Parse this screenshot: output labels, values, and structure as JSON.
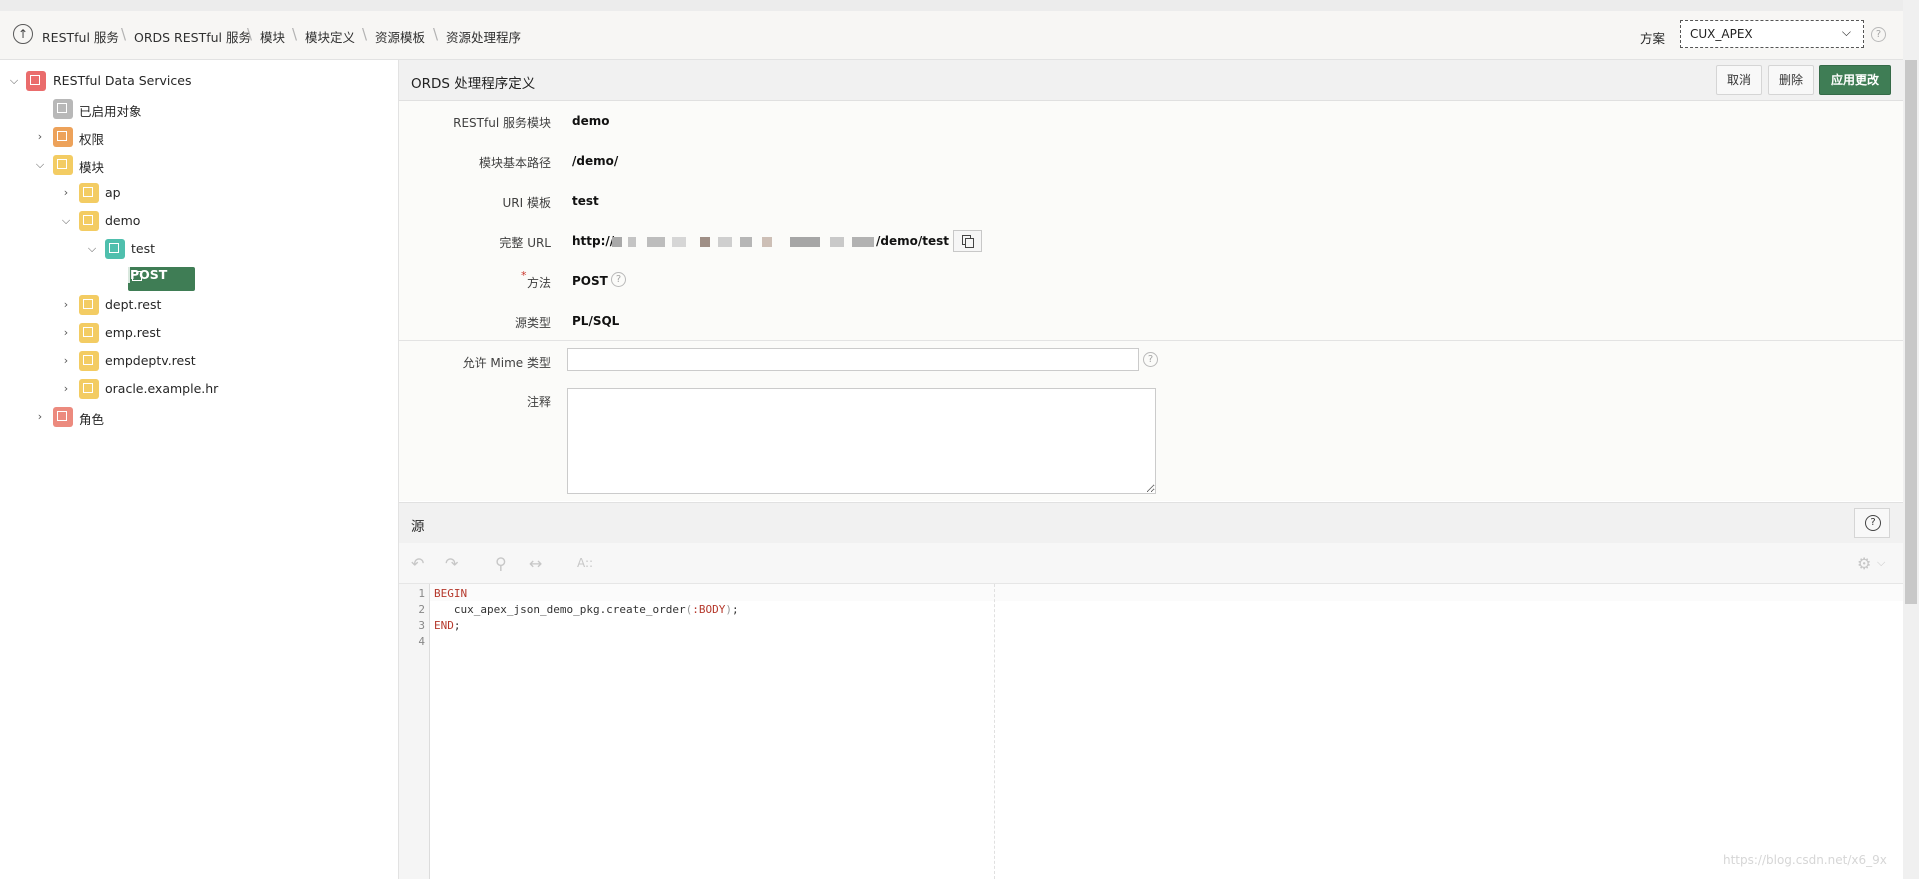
{
  "breadcrumb": [
    "RESTful 服务",
    "ORDS RESTful 服务",
    "模块",
    "模块定义",
    "资源模板",
    "资源处理程序"
  ],
  "schema": {
    "label": "方案",
    "value": "CUX_APEX"
  },
  "tree": {
    "root": "RESTful Data Services",
    "enabled_objects": "已启用对象",
    "privileges": "权限",
    "modules": "模块",
    "module_ap": "ap",
    "module_demo": "demo",
    "template_test": "test",
    "handler_post": "POST",
    "module_dept": "dept.rest",
    "module_emp": "emp.rest",
    "module_empdeptv": "empdeptv.rest",
    "module_oracle": "oracle.example.hr",
    "roles": "角色"
  },
  "region": {
    "title": "ORDS 处理程序定义",
    "cancel": "取消",
    "delete": "删除",
    "apply": "应用更改"
  },
  "form": {
    "module_label": "RESTful 服务模块",
    "module_value": "demo",
    "base_path_label": "模块基本路径",
    "base_path_value": "/demo/",
    "uri_template_label": "URI 模板",
    "uri_template_value": "test",
    "full_url_label": "完整 URL",
    "full_url_prefix": "http://",
    "full_url_suffix": "/demo/test",
    "method_label": "方法",
    "method_value": "POST",
    "source_type_label": "源类型",
    "source_type_value": "PL/SQL",
    "mime_label": "允许 Mime 类型",
    "mime_value": "",
    "comment_label": "注释",
    "comment_value": ""
  },
  "source": {
    "title": "源",
    "toolbar_font": "A::",
    "lines": [
      {
        "num": "1",
        "kw": "BEGIN",
        "text": "",
        "bind": "",
        "tail": ""
      },
      {
        "num": "2",
        "kw": "",
        "text": "   cux_apex_json_demo_pkg.create_order",
        "bind": ":BODY",
        "tail": ";"
      },
      {
        "num": "3",
        "kw": "END",
        "text": "",
        "bind": "",
        "tail": ";"
      },
      {
        "num": "4",
        "kw": "",
        "text": "",
        "bind": "",
        "tail": ""
      }
    ]
  },
  "watermark": "https://blog.csdn.net/x6_9x"
}
